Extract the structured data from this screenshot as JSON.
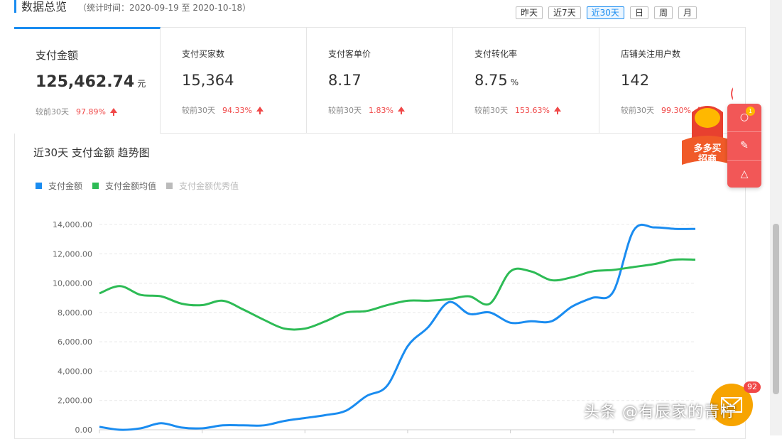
{
  "header": {
    "title": "数据总览",
    "stat_range": "（统计时间：2020-09-19 至 2020-10-18）",
    "range_buttons": [
      "昨天",
      "近7天",
      "近30天",
      "日",
      "周",
      "月"
    ],
    "active_range": "近30天"
  },
  "kpis": [
    {
      "label": "支付金额",
      "value": "125,462.74",
      "unit": "元",
      "compare_label": "较前30天",
      "rate": "97.89%"
    },
    {
      "label": "支付买家数",
      "value": "15,364",
      "unit": "",
      "compare_label": "较前30天",
      "rate": "94.33%"
    },
    {
      "label": "支付客单价",
      "value": "8.17",
      "unit": "",
      "compare_label": "较前30天",
      "rate": "1.83%"
    },
    {
      "label": "支付转化率",
      "value": "8.75",
      "unit": "%",
      "compare_label": "较前30天",
      "rate": "153.63%"
    },
    {
      "label": "店铺关注用户数",
      "value": "142",
      "unit": "",
      "compare_label": "较前30天",
      "rate": "99.30%"
    }
  ],
  "float_panel": {
    "badge": "1"
  },
  "promo": {
    "text": "多多买 招商"
  },
  "mail": {
    "badge": "92"
  },
  "watermark": "头条 @有辰家的青柠",
  "colors": {
    "accent": "#1a8cf0",
    "series_blue": "#1a8cf0",
    "series_green": "#2dbb55",
    "series_gray": "#bbbbbb",
    "rate_up": "#f04848"
  },
  "chart_data": {
    "type": "line",
    "title": "近30天 支付金额 趋势图",
    "xlabel": "",
    "ylabel": "",
    "ylim": [
      0,
      14000
    ],
    "yticks": [
      "0.00",
      "2,000.00",
      "4,000.00",
      "6,000.00",
      "8,000.00",
      "10,000.00",
      "12,000.00",
      "14,000.00"
    ],
    "grid": true,
    "legend_position": "top-left",
    "x": [
      1,
      2,
      3,
      4,
      5,
      6,
      7,
      8,
      9,
      10,
      11,
      12,
      13,
      14,
      15,
      16,
      17,
      18,
      19,
      20,
      21,
      22,
      23,
      24,
      25,
      26,
      27,
      28,
      29,
      30
    ],
    "series": [
      {
        "name": "支付金额",
        "color": "#1a8cf0",
        "values": [
          200,
          0,
          100,
          450,
          150,
          100,
          300,
          300,
          300,
          600,
          800,
          1000,
          1300,
          2300,
          3000,
          5700,
          7000,
          8700,
          7900,
          8000,
          7300,
          7400,
          7400,
          8400,
          9000,
          9400,
          13600,
          13800,
          13700,
          13700
        ]
      },
      {
        "name": "支付金额均值",
        "color": "#2dbb55",
        "values": [
          9300,
          9800,
          9200,
          9100,
          8600,
          8500,
          8800,
          8200,
          7500,
          6900,
          6900,
          7400,
          8000,
          8100,
          8500,
          8800,
          8800,
          8900,
          9100,
          8600,
          10800,
          10800,
          10200,
          10400,
          10800,
          10900,
          11100,
          11300,
          11600,
          11600
        ]
      },
      {
        "name": "支付金额优秀值",
        "color": "#bbbbbb",
        "values": []
      }
    ]
  }
}
